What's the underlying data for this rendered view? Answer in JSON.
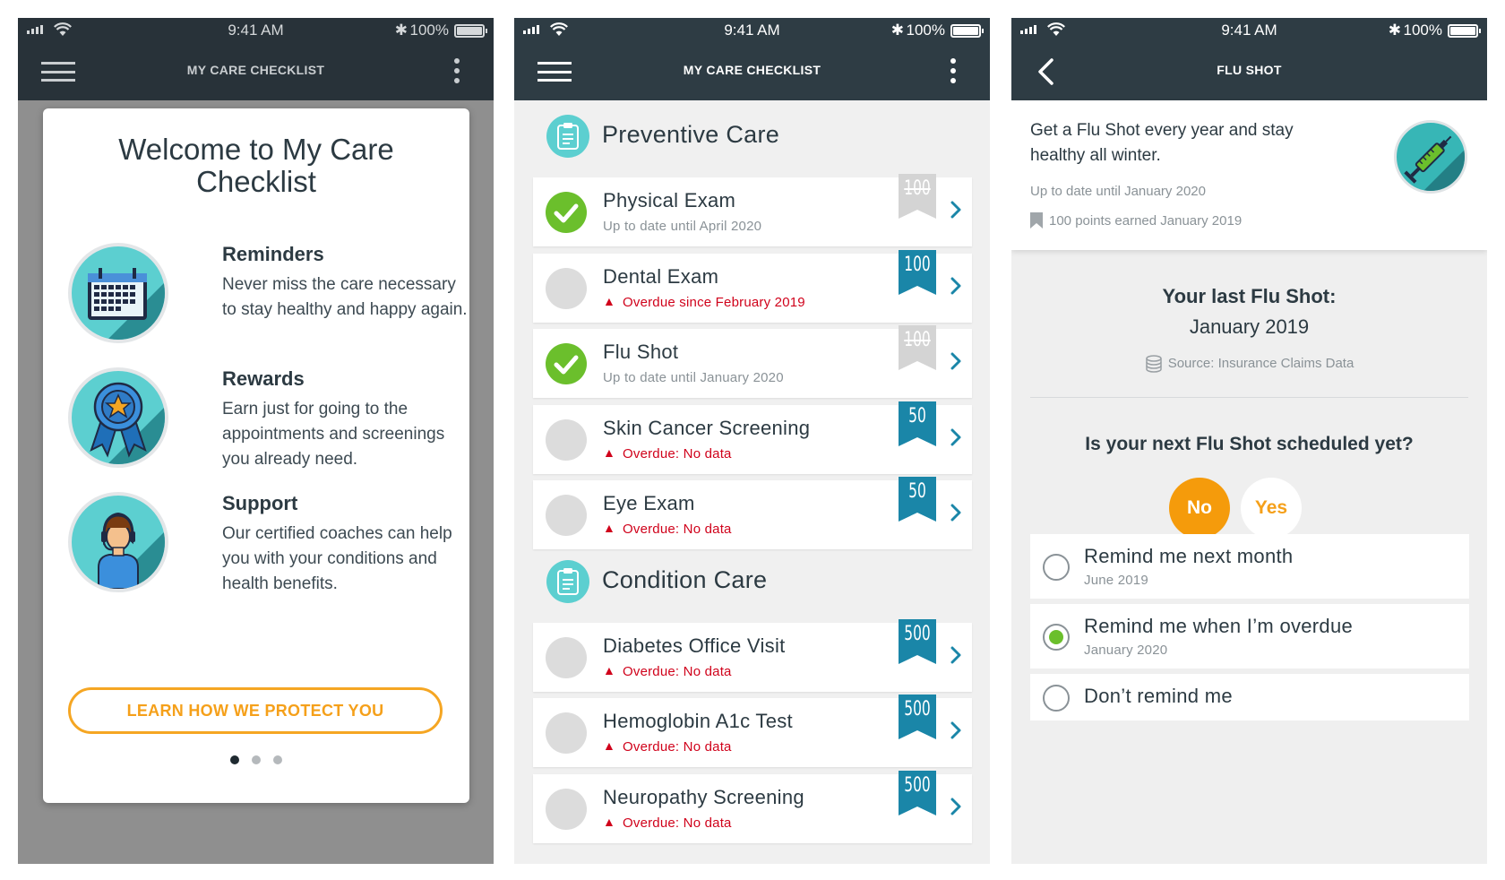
{
  "status_bar": {
    "time": "9:41 AM",
    "battery": "100%"
  },
  "colors": {
    "nav_bg": "#2e3c44",
    "teal": "#5ccfd0",
    "orange": "#f5a623",
    "green": "#6bbf2c",
    "overdue_red": "#d0021b",
    "ribbon_blue": "#1a86a8",
    "ribbon_grey": "#d4d4d4"
  },
  "panel1": {
    "nav_title": "MY CARE CHECKLIST",
    "welcome_title": "Welcome to My Care Checklist",
    "features": [
      {
        "icon": "calendar-icon",
        "title": "Reminders",
        "desc": "Never miss the care necessary to stay healthy and happy again."
      },
      {
        "icon": "award-ribbon-icon",
        "title": "Rewards",
        "desc": "Earn just for going to the appointments and screenings you already need."
      },
      {
        "icon": "coach-headset-icon",
        "title": "Support",
        "desc": "Our certified coaches can help you with your conditions and health benefits."
      }
    ],
    "cta": "LEARN HOW WE PROTECT YOU",
    "pager": {
      "count": 3,
      "active": 1
    }
  },
  "panel2": {
    "nav_title": "MY CARE CHECKLIST",
    "sections": [
      {
        "title": "Preventive Care",
        "icon": "clipboard-icon",
        "items": [
          {
            "name": "Physical Exam",
            "sub": "Up to date until April 2020",
            "done": true,
            "overdue": false,
            "points": "100",
            "earned": true
          },
          {
            "name": "Dental Exam",
            "sub": "Overdue since February 2019",
            "done": false,
            "overdue": true,
            "points": "100",
            "earned": false
          },
          {
            "name": "Flu Shot",
            "sub": "Up to date until January 2020",
            "done": true,
            "overdue": false,
            "points": "100",
            "earned": true
          },
          {
            "name": "Skin Cancer Screening",
            "sub": "Overdue: No data",
            "done": false,
            "overdue": true,
            "points": "50",
            "earned": false
          },
          {
            "name": "Eye Exam",
            "sub": "Overdue: No data",
            "done": false,
            "overdue": true,
            "points": "50",
            "earned": false
          }
        ]
      },
      {
        "title": "Condition Care",
        "icon": "clipboard-icon",
        "items": [
          {
            "name": "Diabetes Office Visit",
            "sub": "Overdue: No data",
            "done": false,
            "overdue": true,
            "points": "500",
            "earned": false
          },
          {
            "name": "Hemoglobin A1c Test",
            "sub": "Overdue: No data",
            "done": false,
            "overdue": true,
            "points": "500",
            "earned": false
          },
          {
            "name": "Neuropathy Screening",
            "sub": "Overdue: No data",
            "done": false,
            "overdue": true,
            "points": "500",
            "earned": false
          }
        ]
      }
    ]
  },
  "panel3": {
    "nav_title": "FLU SHOT",
    "description": "Get a Flu Shot every year and stay healthy all winter.",
    "up_to_date": "Up to date until January 2020",
    "points_earned": "100 points earned January 2019",
    "last_label": "Your last Flu Shot:",
    "last_date": "January 2019",
    "source": "Source: Insurance Claims Data",
    "question": "Is your next Flu Shot scheduled yet?",
    "no_label": "No",
    "yes_label": "Yes",
    "options": [
      {
        "label": "Remind me next month",
        "sub": "June 2019",
        "selected": false
      },
      {
        "label": "Remind me when I’m overdue",
        "sub": "January 2020",
        "selected": true
      },
      {
        "label": "Don’t remind me",
        "sub": "",
        "selected": false
      }
    ]
  }
}
